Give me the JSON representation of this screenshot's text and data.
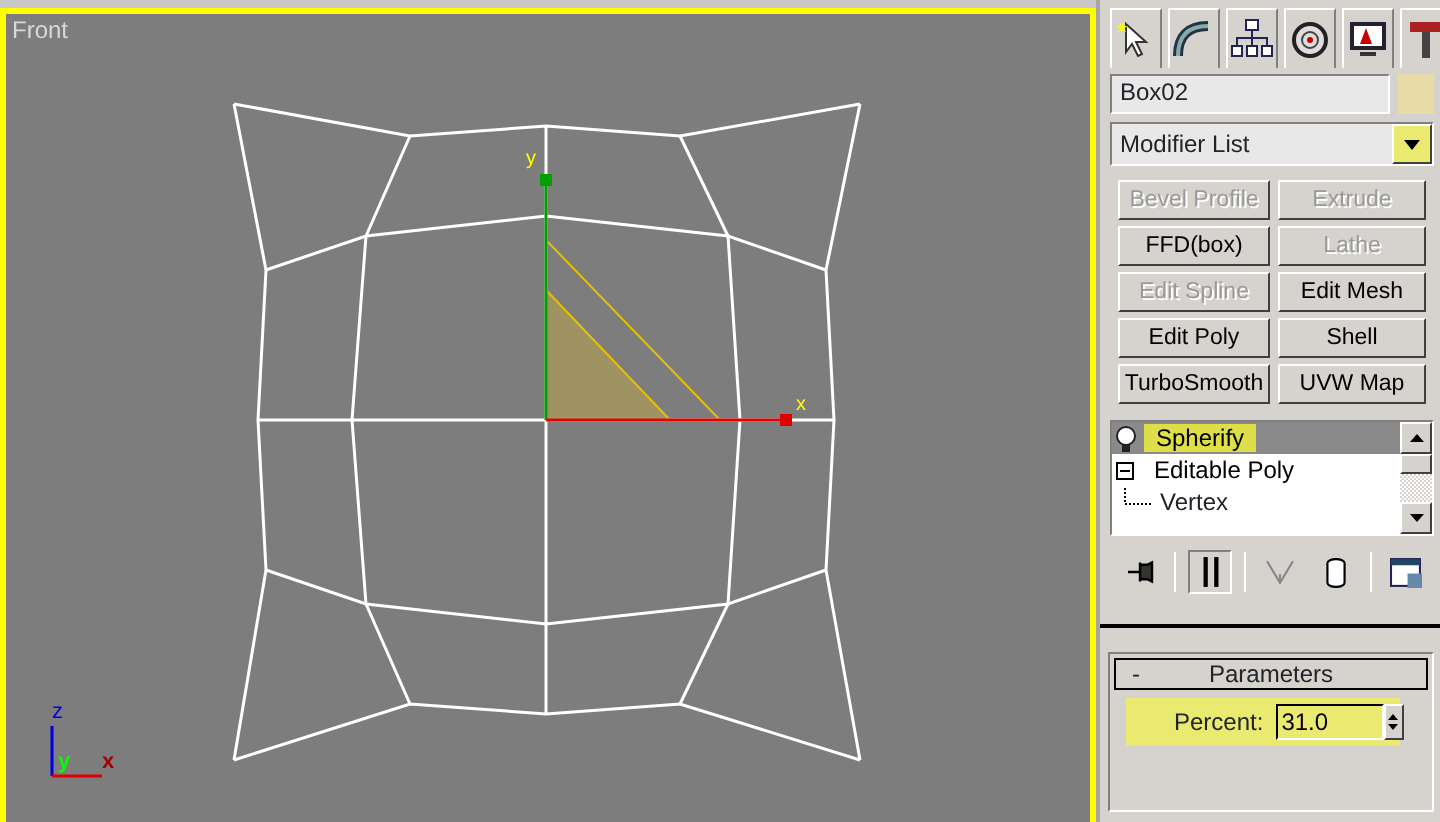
{
  "viewport": {
    "label": "Front",
    "gizmo_labels": [
      "y",
      "x"
    ],
    "tripod_labels": [
      "z",
      "y",
      "x"
    ]
  },
  "command_panel": {
    "tabs": [
      {
        "kind": "create"
      },
      {
        "kind": "modify"
      },
      {
        "kind": "hierarchy"
      },
      {
        "kind": "motion"
      },
      {
        "kind": "display"
      },
      {
        "kind": "utilities"
      }
    ],
    "object_name": "Box02",
    "modifier_list": {
      "value": "Modifier List",
      "highlighted": true
    },
    "buttons": [
      {
        "label": "Bevel Profile",
        "disabled": true
      },
      {
        "label": "Extrude",
        "disabled": true
      },
      {
        "label": "FFD(box)",
        "disabled": false
      },
      {
        "label": "Lathe",
        "disabled": true
      },
      {
        "label": "Edit Spline",
        "disabled": true
      },
      {
        "label": "Edit Mesh",
        "disabled": false
      },
      {
        "label": "Edit Poly",
        "disabled": false
      },
      {
        "label": "Shell",
        "disabled": false
      },
      {
        "label": "TurboSmooth",
        "disabled": false
      },
      {
        "label": "UVW Map",
        "disabled": false
      }
    ],
    "stack": [
      {
        "kind": "modifier",
        "label": "Spherify",
        "selected": true,
        "highlighted": true
      },
      {
        "kind": "object",
        "label": "Editable Poly",
        "selected": false,
        "expanded": true,
        "children": [
          {
            "label": "Vertex"
          }
        ]
      }
    ],
    "stack_tools": [
      {
        "kind": "pin",
        "selected": false
      },
      {
        "kind": "show-end",
        "selected": true
      },
      {
        "kind": "unique",
        "selected": false
      },
      {
        "kind": "remove",
        "selected": false
      },
      {
        "kind": "configure",
        "selected": false
      }
    ],
    "rollout": {
      "toggle": "-",
      "title": "Parameters",
      "fields": [
        {
          "label": "Percent:",
          "value": "31.0",
          "highlighted": true
        }
      ]
    }
  }
}
